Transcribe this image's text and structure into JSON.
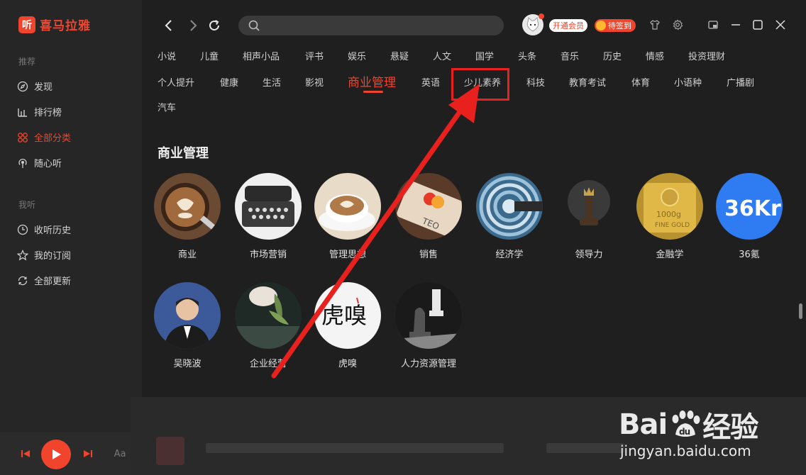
{
  "app": {
    "logo_text": "喜马拉雅",
    "logo_glyph": "听",
    "accent_color": "#f0452c"
  },
  "sidebar": {
    "sections": [
      {
        "title": "推荐",
        "items": [
          {
            "label": "发现",
            "icon": "compass-icon",
            "active": false
          },
          {
            "label": "排行榜",
            "icon": "chart-bar-icon",
            "active": false
          },
          {
            "label": "全部分类",
            "icon": "grid-icon",
            "active": true
          },
          {
            "label": "随心听",
            "icon": "radio-icon",
            "active": false
          }
        ]
      },
      {
        "title": "我听",
        "items": [
          {
            "label": "收听历史",
            "icon": "clock-icon",
            "active": false
          },
          {
            "label": "我的订阅",
            "icon": "star-icon",
            "active": false
          },
          {
            "label": "全部更新",
            "icon": "refresh-icon",
            "active": false
          }
        ]
      }
    ]
  },
  "player": {
    "font_label": "Aa"
  },
  "header": {
    "search_placeholder": "",
    "vip_label": "开通会员",
    "sign_label": "待签到"
  },
  "categories": {
    "row1": [
      "小说",
      "儿童",
      "相声小品",
      "评书",
      "娱乐",
      "悬疑",
      "人文",
      "国学",
      "头条",
      "音乐",
      "历史",
      "情感",
      "投资理财"
    ],
    "row2": [
      "个人提升",
      "健康",
      "生活",
      "影视",
      "商业管理",
      "英语",
      "少儿素养",
      "科技",
      "教育考试",
      "体育",
      "小语种",
      "广播剧"
    ],
    "row3": [
      "汽车"
    ],
    "active": "商业管理",
    "highlighted": "少儿素养"
  },
  "section": {
    "title": "商业管理",
    "items": [
      {
        "label": "商业",
        "image": "coffee-latte-art"
      },
      {
        "label": "市场营销",
        "image": "typewriter"
      },
      {
        "label": "管理思想",
        "image": "coffee-cup"
      },
      {
        "label": "销售",
        "image": "credit-card"
      },
      {
        "label": "经济学",
        "image": "spiral-architecture"
      },
      {
        "label": "领导力",
        "image": "chess-king"
      },
      {
        "label": "金融学",
        "image": "gold-bar"
      },
      {
        "label": "36氪",
        "image": "36kr-logo",
        "logo_text": "36Kr"
      },
      {
        "label": "吴晓波",
        "image": "portrait"
      },
      {
        "label": "企业经营",
        "image": "plant-still-life"
      },
      {
        "label": "虎嗅",
        "image": "huxiu-logo",
        "logo_text": "虎嗅"
      },
      {
        "label": "人力资源管理",
        "image": "chess-pieces"
      }
    ]
  },
  "watermark": {
    "brand": "Bai",
    "brand_tail": "经验",
    "paw_text": "du",
    "url": "jingyan.baidu.com"
  }
}
